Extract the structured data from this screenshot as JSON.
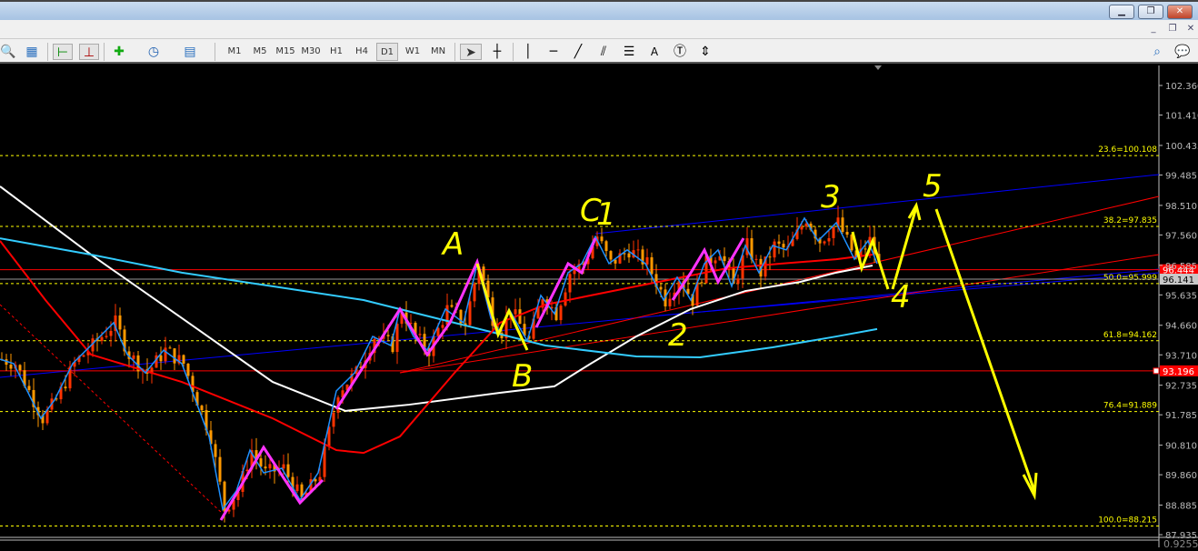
{
  "window": {
    "buttons": [
      "minimize",
      "restore",
      "close"
    ]
  },
  "toolbar": {
    "timeframes": [
      "M1",
      "M5",
      "M15",
      "M30",
      "H1",
      "H4",
      "D1",
      "W1",
      "MN"
    ],
    "active_timeframe": "D1",
    "tools": [
      "cursor",
      "crosshair",
      "vertical-line",
      "horizontal-line",
      "trendline",
      "equidistant-channel",
      "fibonacci",
      "text",
      "text-label",
      "arrows"
    ],
    "text_tool": "A"
  },
  "price_axis": {
    "ticks": [
      "102.360",
      "101.410",
      "100.435",
      "99.485",
      "98.510",
      "97.560",
      "96.585",
      "95.635",
      "94.660",
      "93.710",
      "92.735",
      "91.785",
      "90.810",
      "89.860",
      "88.885",
      "87.935"
    ],
    "tick_values": [
      102.36,
      101.41,
      100.435,
      99.485,
      98.51,
      97.56,
      96.585,
      95.635,
      94.66,
      93.71,
      92.735,
      91.785,
      90.81,
      89.86,
      88.885,
      87.935
    ],
    "bid_label": "96.444",
    "bid": 96.444,
    "ask_label": "96.141",
    "ask": 96.141,
    "level_label": "93.196",
    "level": 93.196,
    "sub_window_label": "0.9255"
  },
  "fib_levels": [
    {
      "label": "23.6=100.108",
      "price": 100.108
    },
    {
      "label": "38.2=97.835",
      "price": 97.835
    },
    {
      "label": "50.0=95.999",
      "price": 95.999
    },
    {
      "label": "61.8=94.162",
      "price": 94.162
    },
    {
      "label": "76.4=91.889",
      "price": 91.889
    },
    {
      "label": "100.0=88.215",
      "price": 88.215
    }
  ],
  "annotations": {
    "A": "A",
    "B": "B",
    "C": "C",
    "w1": "1",
    "w2": "2",
    "w3": "3",
    "w4": "4",
    "w5": "5"
  },
  "colors": {
    "bull": "#ff3300",
    "bear": "#ff9900",
    "fib": "#ffff00",
    "ma_fast": "#ff0000",
    "ma_slow": "#ffffff",
    "ma_cyan": "#33ccff",
    "trend_blue": "#0000ff",
    "wave": "#ff33ff",
    "signal": "#1e90ff"
  },
  "chart_data": {
    "type": "line",
    "ylim": [
      87.5,
      102.9
    ],
    "price": [
      [
        0,
        93.57
      ],
      [
        3,
        93.43
      ],
      [
        6,
        92.55
      ],
      [
        9,
        91.67
      ],
      [
        12,
        92.26
      ],
      [
        16,
        93.43
      ],
      [
        20,
        94.01
      ],
      [
        25,
        94.74
      ],
      [
        28,
        93.72
      ],
      [
        32,
        93.13
      ],
      [
        36,
        93.86
      ],
      [
        40,
        93.43
      ],
      [
        43,
        92.26
      ],
      [
        46,
        91.09
      ],
      [
        49,
        88.75
      ],
      [
        52,
        89.34
      ],
      [
        55,
        90.65
      ],
      [
        58,
        89.92
      ],
      [
        62,
        90.07
      ],
      [
        66,
        89.05
      ],
      [
        70,
        89.92
      ],
      [
        74,
        92.55
      ],
      [
        78,
        93.13
      ],
      [
        82,
        94.3
      ],
      [
        86,
        94.01
      ],
      [
        88,
        95.18
      ],
      [
        91,
        94.3
      ],
      [
        94,
        93.86
      ],
      [
        98,
        95.18
      ],
      [
        102,
        94.74
      ],
      [
        105,
        96.64
      ],
      [
        108,
        94.89
      ],
      [
        110,
        94.45
      ],
      [
        112,
        95.18
      ],
      [
        116,
        94.16
      ],
      [
        119,
        95.62
      ],
      [
        122,
        95.03
      ],
      [
        125,
        96.35
      ],
      [
        128,
        96.64
      ],
      [
        131,
        97.51
      ],
      [
        134,
        96.64
      ],
      [
        138,
        97.08
      ],
      [
        142,
        96.64
      ],
      [
        146,
        95.47
      ],
      [
        149,
        96.2
      ],
      [
        152,
        95.47
      ],
      [
        155,
        96.64
      ],
      [
        158,
        97.08
      ],
      [
        161,
        95.91
      ],
      [
        164,
        97.22
      ],
      [
        167,
        96.35
      ],
      [
        170,
        97.22
      ],
      [
        173,
        97.08
      ],
      [
        177,
        98.1
      ],
      [
        180,
        97.37
      ],
      [
        184,
        97.95
      ],
      [
        188,
        96.78
      ],
      [
        191,
        97.37
      ],
      [
        193,
        96.64
      ]
    ],
    "ma_slow": [
      [
        0,
        99.12
      ],
      [
        20,
        96.93
      ],
      [
        40,
        94.89
      ],
      [
        60,
        92.84
      ],
      [
        76,
        91.91
      ],
      [
        90,
        92.11
      ],
      [
        110,
        92.49
      ],
      [
        122,
        92.7
      ],
      [
        130,
        93.43
      ],
      [
        140,
        94.3
      ],
      [
        152,
        95.18
      ],
      [
        164,
        95.76
      ],
      [
        176,
        96.05
      ],
      [
        184,
        96.35
      ],
      [
        192,
        96.58
      ]
    ],
    "ma_cyan": [
      [
        0,
        97.45
      ],
      [
        20,
        96.93
      ],
      [
        40,
        96.35
      ],
      [
        60,
        95.91
      ],
      [
        80,
        95.47
      ],
      [
        100,
        94.74
      ],
      [
        120,
        94.01
      ],
      [
        140,
        93.66
      ],
      [
        154,
        93.63
      ],
      [
        170,
        93.95
      ],
      [
        184,
        94.3
      ],
      [
        193,
        94.54
      ]
    ],
    "ma_fast": [
      [
        0,
        97.37
      ],
      [
        10,
        95.47
      ],
      [
        20,
        93.72
      ],
      [
        40,
        92.84
      ],
      [
        60,
        91.67
      ],
      [
        74,
        90.65
      ],
      [
        80,
        90.56
      ],
      [
        88,
        91.09
      ],
      [
        100,
        93.13
      ],
      [
        110,
        94.74
      ],
      [
        120,
        95.32
      ],
      [
        130,
        95.62
      ],
      [
        140,
        95.91
      ],
      [
        150,
        96.2
      ],
      [
        160,
        96.49
      ],
      [
        172,
        96.64
      ],
      [
        184,
        96.78
      ],
      [
        192,
        96.93
      ]
    ]
  }
}
